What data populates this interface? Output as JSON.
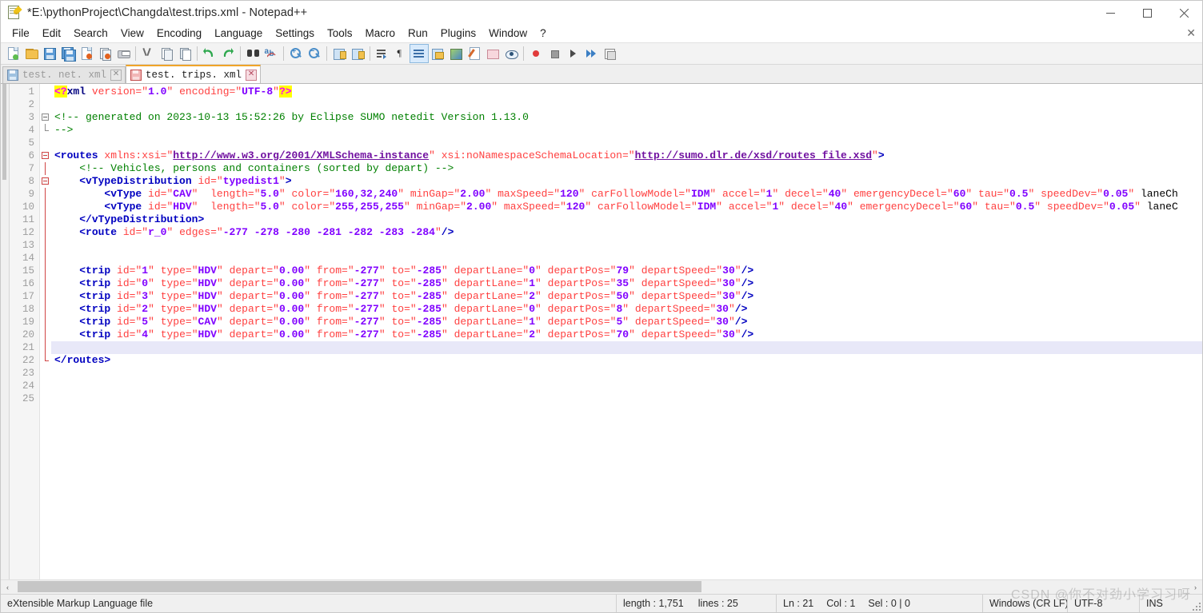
{
  "window": {
    "title": "*E:\\pythonProject\\Changda\\test.trips.xml - Notepad++",
    "icon": "notepad-plus-plus-icon",
    "minimize": "—",
    "maximize": "□",
    "close": "✕"
  },
  "menu": {
    "items": [
      {
        "label": "File"
      },
      {
        "label": "Edit"
      },
      {
        "label": "Search"
      },
      {
        "label": "View"
      },
      {
        "label": "Encoding"
      },
      {
        "label": "Language"
      },
      {
        "label": "Settings"
      },
      {
        "label": "Tools"
      },
      {
        "label": "Macro"
      },
      {
        "label": "Run"
      },
      {
        "label": "Plugins"
      },
      {
        "label": "Window"
      },
      {
        "label": "?"
      }
    ],
    "document_close": "✕"
  },
  "toolbar": {
    "buttons": [
      {
        "name": "new-file-icon"
      },
      {
        "name": "open-file-icon"
      },
      {
        "name": "save-icon"
      },
      {
        "name": "save-all-icon"
      },
      {
        "name": "close-document-icon"
      },
      {
        "name": "close-all-documents-icon"
      },
      {
        "name": "print-icon"
      },
      {
        "name": "cut-icon"
      },
      {
        "name": "copy-icon"
      },
      {
        "name": "paste-icon"
      },
      {
        "name": "undo-icon"
      },
      {
        "name": "redo-icon"
      },
      {
        "name": "find-icon"
      },
      {
        "name": "replace-icon"
      },
      {
        "name": "zoom-in-icon"
      },
      {
        "name": "zoom-out-icon"
      },
      {
        "name": "sync-vertical-scroll-icon"
      },
      {
        "name": "sync-horizontal-scroll-icon"
      },
      {
        "name": "word-wrap-icon"
      },
      {
        "name": "show-all-characters-icon"
      },
      {
        "name": "indent-guide-icon"
      },
      {
        "name": "user-defined-dialog-icon"
      },
      {
        "name": "document-map-icon"
      },
      {
        "name": "function-list-icon"
      },
      {
        "name": "folder-as-workspace-icon"
      },
      {
        "name": "monitoring-icon"
      },
      {
        "name": "record-macro-icon"
      },
      {
        "name": "stop-recording-macro-icon"
      },
      {
        "name": "play-macro-icon"
      },
      {
        "name": "run-macro-multiple-icon"
      },
      {
        "name": "save-current-macro-icon"
      }
    ]
  },
  "tabs": [
    {
      "label": "test. net. xml",
      "active": false,
      "modified": false,
      "close": "✕",
      "icon": "floppy-icon"
    },
    {
      "label": "test. trips. xml",
      "active": true,
      "modified": true,
      "close": "✕",
      "icon": "floppy-modified-icon"
    }
  ],
  "editor": {
    "total_lines": 25,
    "current_line": 21,
    "lines": [
      {
        "n": 1,
        "fold": "none"
      },
      {
        "n": 2,
        "fold": "none"
      },
      {
        "n": 3,
        "fold": "open"
      },
      {
        "n": 4,
        "fold": "end"
      },
      {
        "n": 5,
        "fold": "none"
      },
      {
        "n": 6,
        "fold": "open-red"
      },
      {
        "n": 7,
        "fold": "bar-red"
      },
      {
        "n": 8,
        "fold": "open-red"
      },
      {
        "n": 9,
        "fold": "bar-red"
      },
      {
        "n": 10,
        "fold": "bar-red"
      },
      {
        "n": 11,
        "fold": "bar-red"
      },
      {
        "n": 12,
        "fold": "bar-red"
      },
      {
        "n": 13,
        "fold": "bar-red"
      },
      {
        "n": 14,
        "fold": "bar-red"
      },
      {
        "n": 15,
        "fold": "bar-red"
      },
      {
        "n": 16,
        "fold": "bar-red"
      },
      {
        "n": 17,
        "fold": "bar-red"
      },
      {
        "n": 18,
        "fold": "bar-red"
      },
      {
        "n": 19,
        "fold": "bar-red"
      },
      {
        "n": 20,
        "fold": "bar-red"
      },
      {
        "n": 21,
        "fold": "bar-red"
      },
      {
        "n": 22,
        "fold": "end-red"
      },
      {
        "n": 23,
        "fold": "none"
      },
      {
        "n": 24,
        "fold": "none"
      },
      {
        "n": 25,
        "fold": "none"
      }
    ],
    "text_lines": [
      "<?xml version=\"1.0\" encoding=\"UTF-8\"?>",
      "",
      "<!-- generated on 2023-10-13 15:52:26 by Eclipse SUMO netedit Version 1.13.0",
      "-->",
      "",
      "<routes xmlns:xsi=\"http://www.w3.org/2001/XMLSchema-instance\" xsi:noNamespaceSchemaLocation=\"http://sumo.dlr.de/xsd/routes_file.xsd\">",
      "    <!-- Vehicles, persons and containers (sorted by depart) -->",
      "    <vTypeDistribution id=\"typedist1\">",
      "        <vType id=\"CAV\"  length=\"5.0\" color=\"160,32,240\" minGap=\"2.00\" maxSpeed=\"120\" carFollowModel=\"IDM\" accel=\"1\" decel=\"40\" emergencyDecel=\"60\" tau=\"0.5\" speedDev=\"0.05\" laneCh",
      "        <vType id=\"HDV\"  length=\"5.0\" color=\"255,255,255\" minGap=\"2.00\" maxSpeed=\"120\" carFollowModel=\"IDM\" accel=\"1\" decel=\"40\" emergencyDecel=\"60\" tau=\"0.5\" speedDev=\"0.05\" laneC",
      "    </vTypeDistribution>",
      "    <route id=\"r_0\" edges=\"-277 -278 -280 -281 -282 -283 -284\"/>",
      "",
      "",
      "    <trip id=\"1\" type=\"HDV\" depart=\"0.00\" from=\"-277\" to=\"-285\" departLane=\"0\" departPos=\"79\" departSpeed=\"30\"/>",
      "    <trip id=\"0\" type=\"HDV\" depart=\"0.00\" from=\"-277\" to=\"-285\" departLane=\"1\" departPos=\"35\" departSpeed=\"30\"/>",
      "    <trip id=\"3\" type=\"HDV\" depart=\"0.00\" from=\"-277\" to=\"-285\" departLane=\"2\" departPos=\"50\" departSpeed=\"30\"/>",
      "    <trip id=\"2\" type=\"HDV\" depart=\"0.00\" from=\"-277\" to=\"-285\" departLane=\"0\" departPos=\"8\" departSpeed=\"30\"/>",
      "    <trip id=\"5\" type=\"CAV\" depart=\"0.00\" from=\"-277\" to=\"-285\" departLane=\"1\" departPos=\"5\" departSpeed=\"30\"/>",
      "    <trip id=\"4\" type=\"HDV\" depart=\"0.00\" from=\"-277\" to=\"-285\" departLane=\"2\" departPos=\"70\" departSpeed=\"30\"/>",
      "",
      "</routes>",
      "",
      "",
      ""
    ]
  },
  "scrollbar": {
    "left_arrow": "‹",
    "right_arrow": "›"
  },
  "statusbar": {
    "doc_type": "eXtensible Markup Language file",
    "length_label": "length : 1,751",
    "lines_label": "lines : 25",
    "ln": "Ln : 21",
    "col": "Col : 1",
    "sel": "Sel : 0 | 0",
    "eol": "Windows (CR LF)",
    "encoding": "UTF-8",
    "insert_mode": "INS"
  },
  "watermark": {
    "text": "CSDN @你不对劲小学习习呀"
  },
  "colors": {
    "tag": "#0000c0",
    "attribute": "#ff4040",
    "value": "#8000ff",
    "comment": "#008000",
    "highlight": "#ffff00",
    "active_tab_accent": "#f0a429",
    "current_line": "#e8e8f8"
  }
}
